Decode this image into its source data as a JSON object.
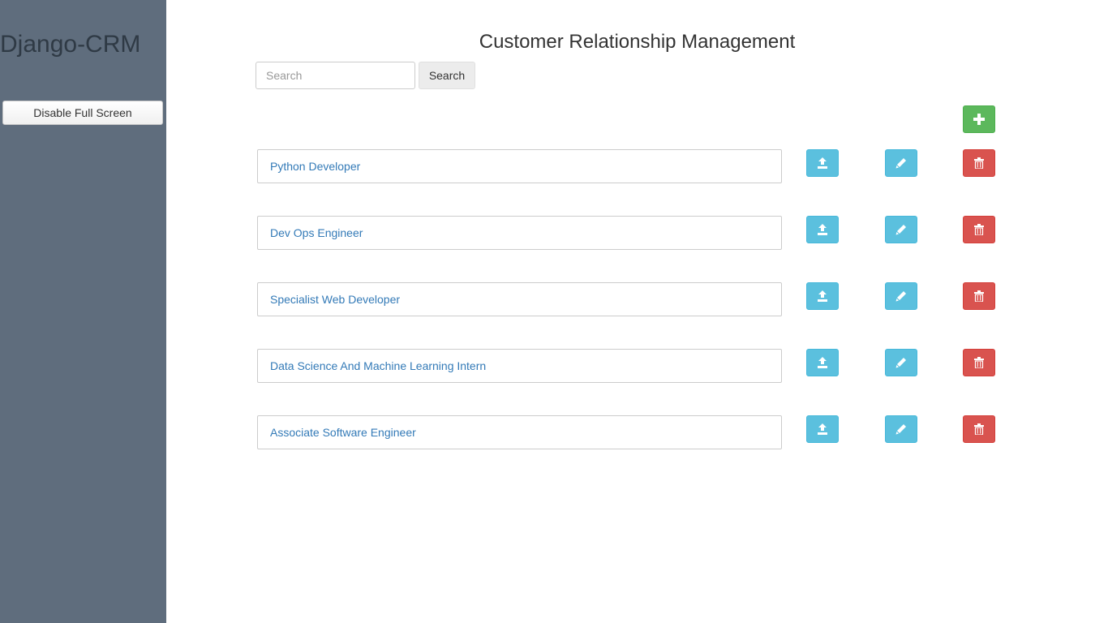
{
  "sidebar": {
    "brand": "Django-CRM",
    "fullscreen_button_label": "Disable Full Screen"
  },
  "header": {
    "title": "Customer Relationship Management"
  },
  "search": {
    "placeholder": "Search",
    "value": "",
    "button_label": "Search"
  },
  "toolbar": {
    "add_icon": "plus-icon"
  },
  "items": [
    {
      "label": "Python Developer"
    },
    {
      "label": "Dev Ops Engineer"
    },
    {
      "label": "Specialist Web Developer"
    },
    {
      "label": "Data Science And Machine Learning Intern"
    },
    {
      "label": "Associate Software Engineer"
    }
  ],
  "actions": {
    "upload_icon": "upload-icon",
    "edit_icon": "pencil-icon",
    "delete_icon": "trash-icon"
  },
  "colors": {
    "sidebar_bg": "#5f6d7d",
    "success": "#5cb85c",
    "info": "#5bc0de",
    "danger": "#d9534f",
    "link": "#337ab7"
  }
}
